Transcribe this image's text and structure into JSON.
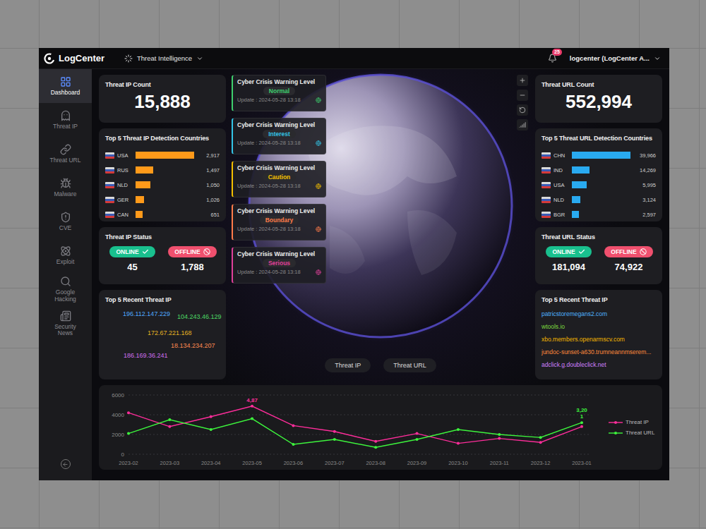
{
  "topbar": {
    "logo": "LogCenter",
    "nav": "Threat Intelligence",
    "notifications": "25",
    "user": "logcenter (LogCenter A..."
  },
  "sidebar": {
    "items": [
      {
        "label": "Dashboard",
        "selected": true
      },
      {
        "label": "Threat IP",
        "selected": false
      },
      {
        "label": "Threat URL",
        "selected": false
      },
      {
        "label": "Malware",
        "selected": false
      },
      {
        "label": "CVE",
        "selected": false
      },
      {
        "label": "Exploit",
        "selected": false
      },
      {
        "label": "Google Hacking",
        "selected": false
      },
      {
        "label": "Security News",
        "selected": false
      }
    ]
  },
  "threat_ip": {
    "count_title": "Threat IP Count",
    "count": "15,888",
    "countries_title": "Top 5 Threat IP Detection Countries",
    "countries": [
      {
        "code": "USA",
        "value": "2,917",
        "level": 1.0
      },
      {
        "code": "RUS",
        "value": "1,497",
        "level": 0.3
      },
      {
        "code": "NLD",
        "value": "1,050",
        "level": 0.25
      },
      {
        "code": "GER",
        "value": "1,026",
        "level": 0.15
      },
      {
        "code": "CAN",
        "value": "651",
        "level": 0.12
      }
    ],
    "status_title": "Threat IP Status",
    "online_label": "ONLINE",
    "offline_label": "OFFLINE",
    "online": "45",
    "offline": "1,788",
    "recent_title": "Top 5 Recent Threat IP",
    "recent": [
      {
        "text": "196.112.147.229",
        "color": "#4fa8ff"
      },
      {
        "text": "104.243.46.129",
        "color": "#4cd964"
      },
      {
        "text": "172.67.221.168",
        "color": "#e6b422"
      },
      {
        "text": "18.134.234.207",
        "color": "#ff8a50"
      },
      {
        "text": "186.169.36.241",
        "color": "#d070f0"
      }
    ]
  },
  "threat_url": {
    "count_title": "Threat URL Count",
    "count": "552,994",
    "countries_title": "Top 5 Threat URL Detection Countries",
    "countries": [
      {
        "code": "CHN",
        "value": "39,966",
        "level": 1.0
      },
      {
        "code": "IND",
        "value": "14,269",
        "level": 0.3
      },
      {
        "code": "USA",
        "value": "5,995",
        "level": 0.25
      },
      {
        "code": "NLD",
        "value": "3,124",
        "level": 0.15
      },
      {
        "code": "BGR",
        "value": "2,597",
        "level": 0.12
      }
    ],
    "status_title": "Threat URL Status",
    "online_label": "ONLINE",
    "offline_label": "OFFLINE",
    "online": "181,094",
    "offline": "74,922",
    "recent_title": "Top 5 Recent Threat IP",
    "recent": [
      {
        "text": "patricstoremegans2.com",
        "color": "#4fb3ff"
      },
      {
        "text": "wtools.io",
        "color": "#7ddc3f"
      },
      {
        "text": "xbo.members.openarmscv.com",
        "color": "#f5b700"
      },
      {
        "text": "jundoc-sunset-a630.trumneannmserem...",
        "color": "#ff8a3c"
      },
      {
        "text": "adclick.g.doubleclick.net",
        "color": "#d080ff"
      }
    ]
  },
  "warning_levels": [
    {
      "title": "Cyber Crisis Warning Level",
      "level": "Normal",
      "update": "Update : 2024-05-28 13:18",
      "color": "#3ecf6e"
    },
    {
      "title": "Cyber Crisis Warning Level",
      "level": "Interest",
      "update": "Update : 2024-05-28 13:18",
      "color": "#33c6e8"
    },
    {
      "title": "Cyber Crisis Warning Level",
      "level": "Caution",
      "update": "Update : 2024-05-28 13:18",
      "color": "#f5c000"
    },
    {
      "title": "Cyber Crisis Warning Level",
      "level": "Boundary",
      "update": "Update : 2024-05-28 13:18",
      "color": "#ff7b4a"
    },
    {
      "title": "Cyber Crisis Warning Level",
      "level": "Serious",
      "update": "Update : 2024-05-28 13:18",
      "color": "#e0409a"
    }
  ],
  "map_buttons": [
    "Threat IP",
    "Threat URL"
  ],
  "chart": {
    "y_ticks": [
      "6000",
      "4000",
      "2000",
      "0"
    ],
    "x_ticks": [
      "2023-02",
      "2023-03",
      "2023-04",
      "2023-05",
      "2023-06",
      "2023-07",
      "2023-08",
      "2023-09",
      "2023-10",
      "2023-11",
      "2023-12",
      "2023-01"
    ],
    "series": [
      {
        "name": "Threat IP",
        "color": "#ff2d9b",
        "values": [
          4200,
          2800,
          3800,
          4870,
          2900,
          2300,
          1300,
          2100,
          1100,
          1600,
          1200,
          2800
        ],
        "point_labels": [
          {
            "index": 3,
            "lines": [
              "4,87"
            ]
          }
        ]
      },
      {
        "name": "Threat URL",
        "color": "#3df53d",
        "values": [
          2100,
          3500,
          2500,
          3600,
          1000,
          1500,
          700,
          1500,
          2500,
          2000,
          1700,
          3201
        ],
        "point_labels": [
          {
            "index": 11,
            "lines": [
              "3,20",
              "1"
            ]
          }
        ]
      }
    ]
  }
}
